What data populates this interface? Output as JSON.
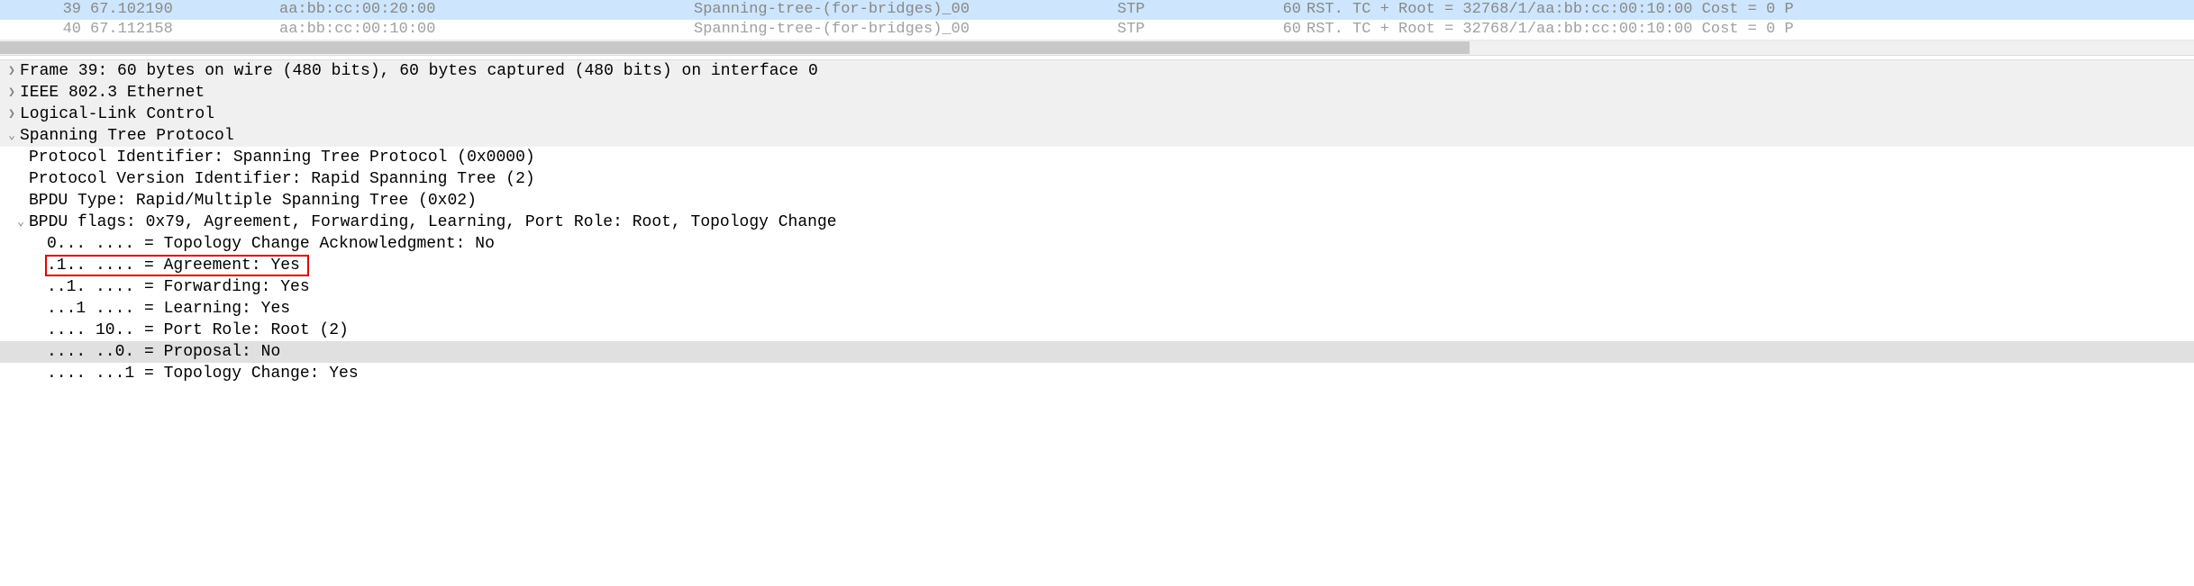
{
  "packets": [
    {
      "no": "39",
      "time": "67.102190",
      "src": "aa:bb:cc:00:20:00",
      "dst": "Spanning-tree-(for-bridges)_00",
      "proto": "STP",
      "len": "60",
      "info": "RST. TC + Root = 32768/1/aa:bb:cc:00:10:00  Cost = 0  P"
    },
    {
      "no": "40",
      "time": "67.112158",
      "src": "aa:bb:cc:00:10:00",
      "dst": "Spanning-tree-(for-bridges)_00",
      "proto": "STP",
      "len": "60",
      "info": "RST. TC + Root = 32768/1/aa:bb:cc:00:10:00  Cost = 0  P"
    }
  ],
  "details": {
    "frame": "Frame 39: 60 bytes on wire (480 bits), 60 bytes captured (480 bits) on interface 0",
    "ieee": "IEEE 802.3 Ethernet",
    "llc": "Logical-Link Control",
    "stp": "Spanning Tree Protocol",
    "proto_id": "Protocol Identifier: Spanning Tree Protocol (0x0000)",
    "ver_id": "Protocol Version Identifier: Rapid Spanning Tree (2)",
    "bpdu_type": "BPDU Type: Rapid/Multiple Spanning Tree (0x02)",
    "bpdu_flags": "BPDU flags: 0x79, Agreement, Forwarding, Learning, Port Role: Root, Topology Change",
    "f_tca": "0... .... = Topology Change Acknowledgment: No",
    "f_agree": ".1.. .... = Agreement: Yes",
    "f_fwd": "..1. .... = Forwarding: Yes",
    "f_learn": "...1 .... = Learning: Yes",
    "f_role": ".... 10.. = Port Role: Root (2)",
    "f_prop": ".... ..0. = Proposal: No",
    "f_tc": ".... ...1 = Topology Change: Yes"
  }
}
